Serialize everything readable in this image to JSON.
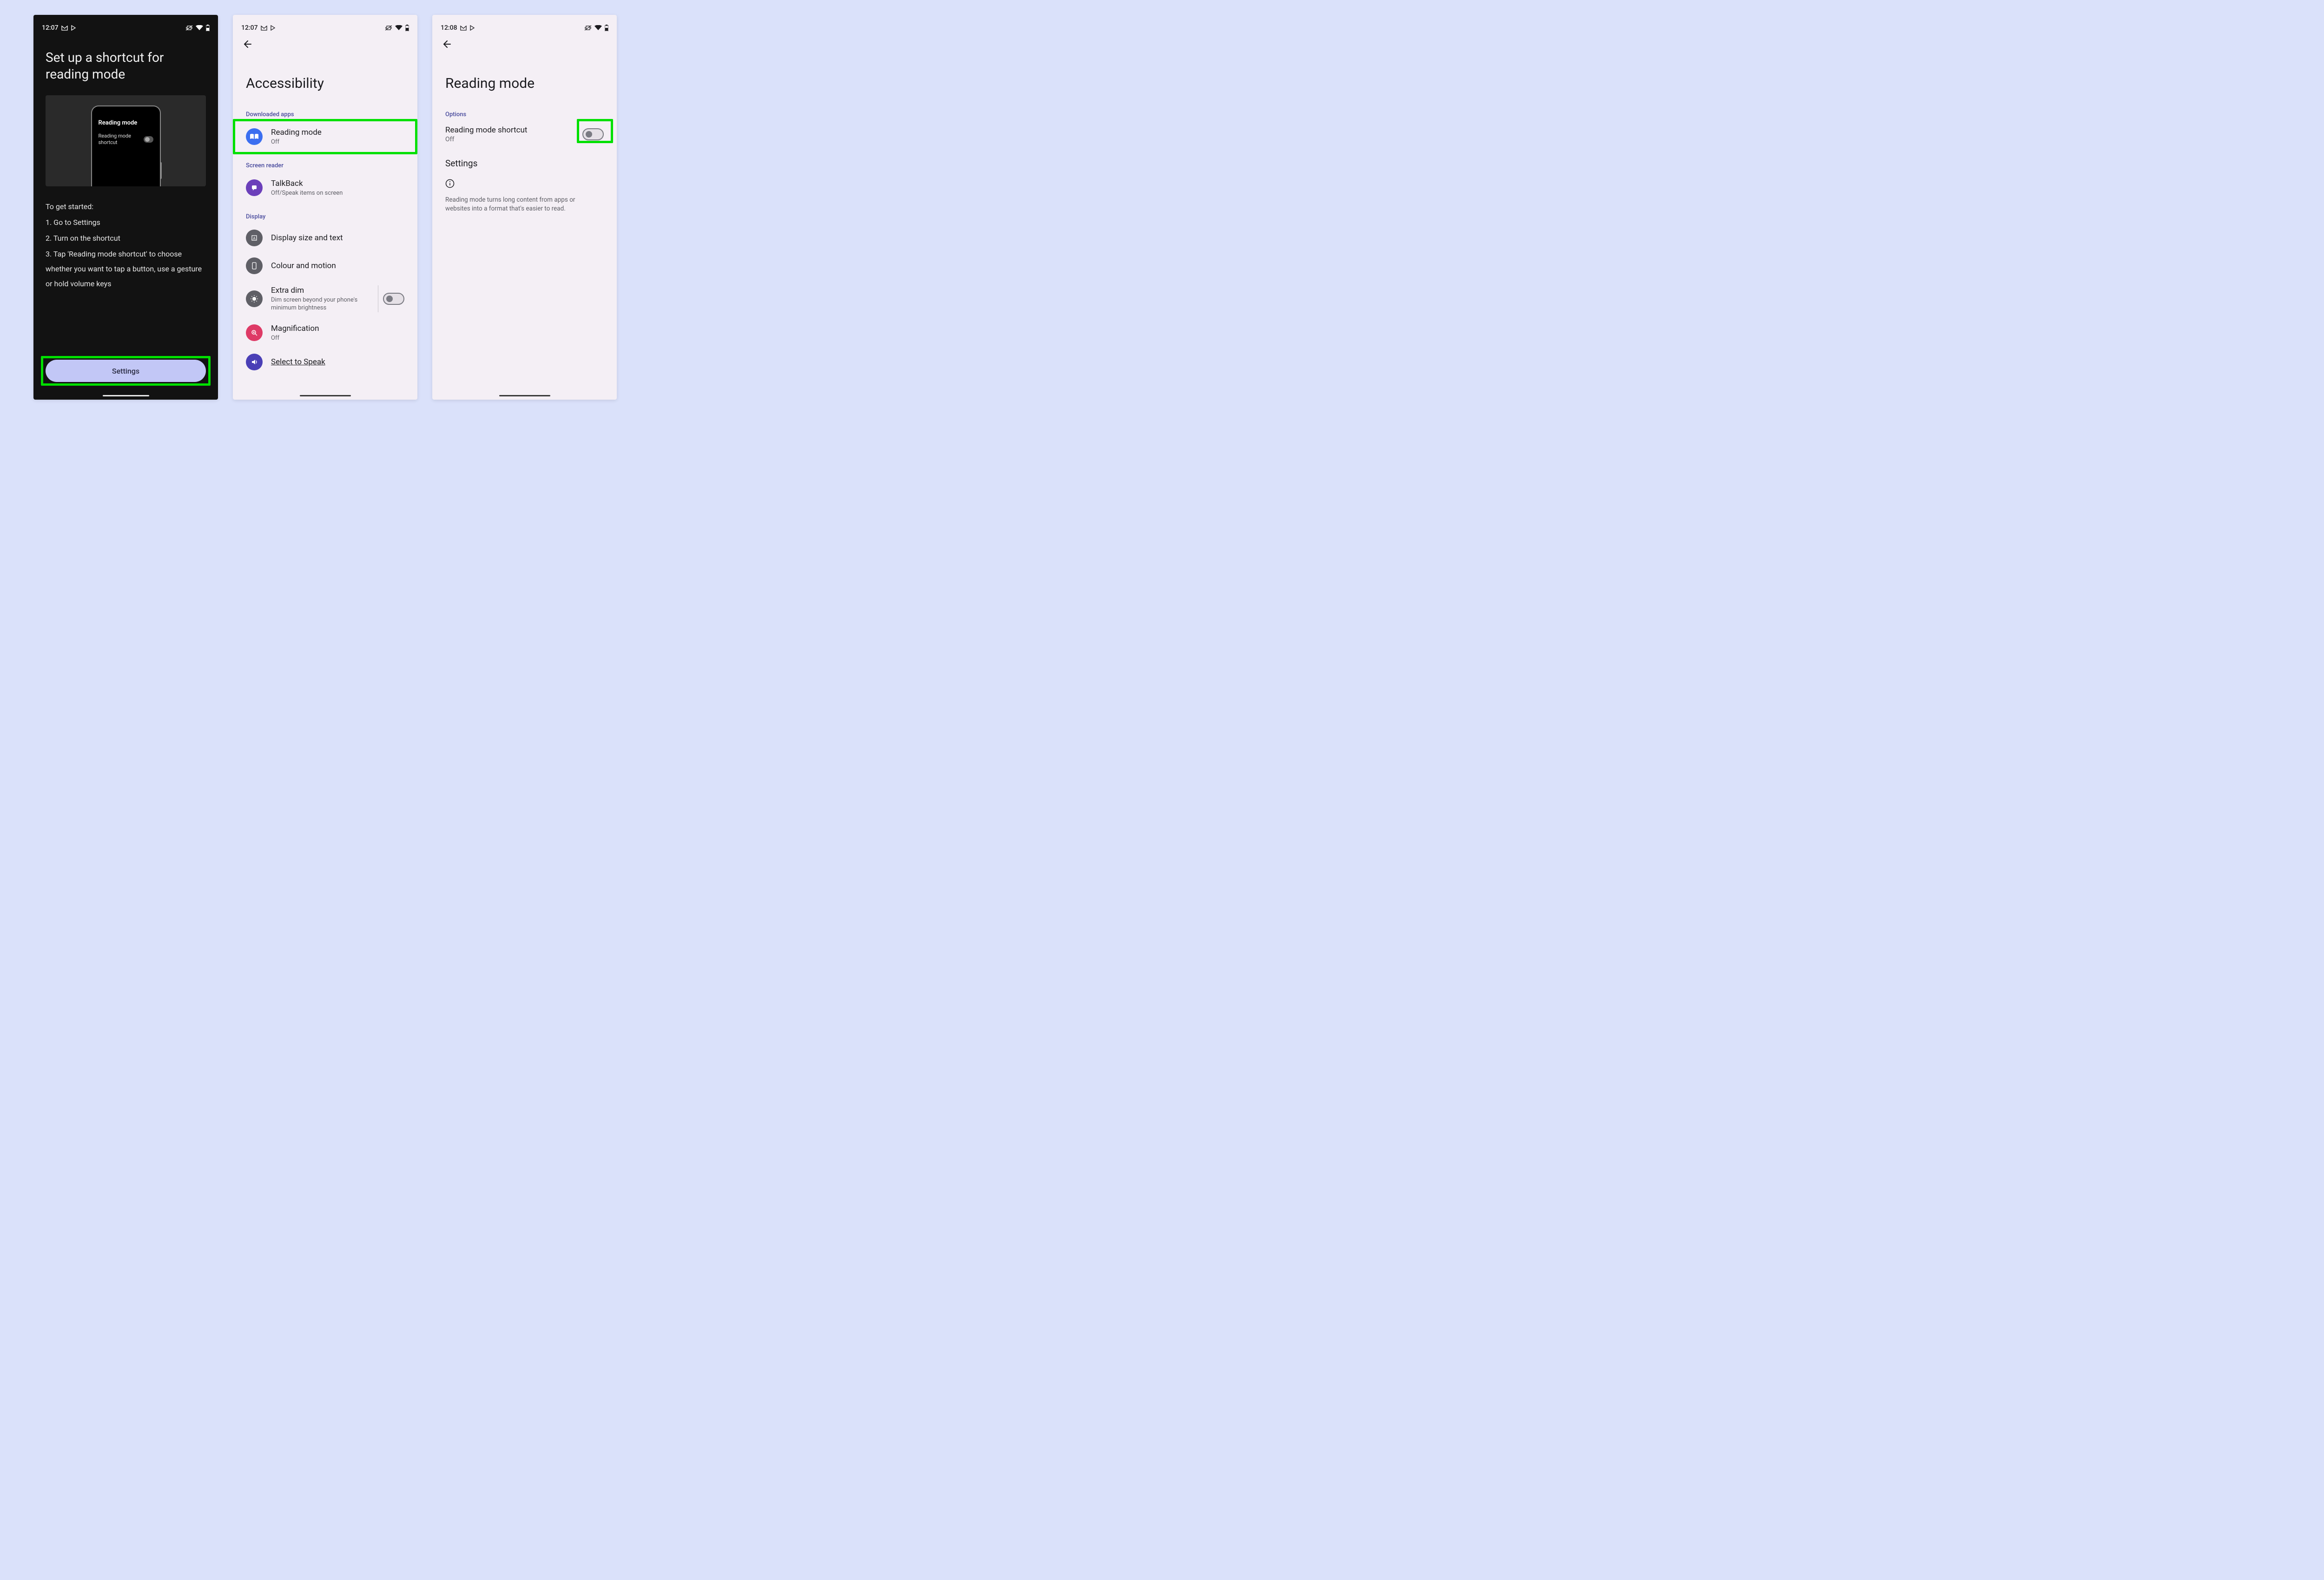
{
  "status": {
    "time1": "12:07",
    "time2": "12:07",
    "time3": "12:08"
  },
  "screen1": {
    "title": "Set up a shortcut for reading mode",
    "illus_title": "Reading mode",
    "illus_sub": "Reading mode shortcut",
    "body_intro": "To get started:",
    "body_1": "1. Go to Settings",
    "body_2": "2. Turn on the shortcut",
    "body_3": "3. Tap 'Reading mode shortcut' to choose whether you want to tap a button, use a gesture or hold volume keys",
    "button": "Settings"
  },
  "screen2": {
    "title": "Accessibility",
    "sec_downloaded": "Downloaded apps",
    "sec_screenreader": "Screen reader",
    "sec_display": "Display",
    "items": {
      "reading_mode": {
        "title": "Reading mode",
        "sub": "Off"
      },
      "talkback": {
        "title": "TalkBack",
        "sub": "Off/Speak items on screen"
      },
      "display_size": {
        "title": "Display size and text"
      },
      "colour_motion": {
        "title": "Colour and motion"
      },
      "extra_dim": {
        "title": "Extra dim",
        "sub": "Dim screen beyond your phone's minimum brightness"
      },
      "magnification": {
        "title": "Magnification",
        "sub": "Off"
      },
      "select_speak": {
        "title": "Select to Speak"
      }
    }
  },
  "screen3": {
    "title": "Reading mode",
    "sec_options": "Options",
    "shortcut": {
      "title": "Reading mode shortcut",
      "sub": "Off"
    },
    "settings_heading": "Settings",
    "description": "Reading mode turns long content from apps or websites into a format that's easier to read."
  }
}
